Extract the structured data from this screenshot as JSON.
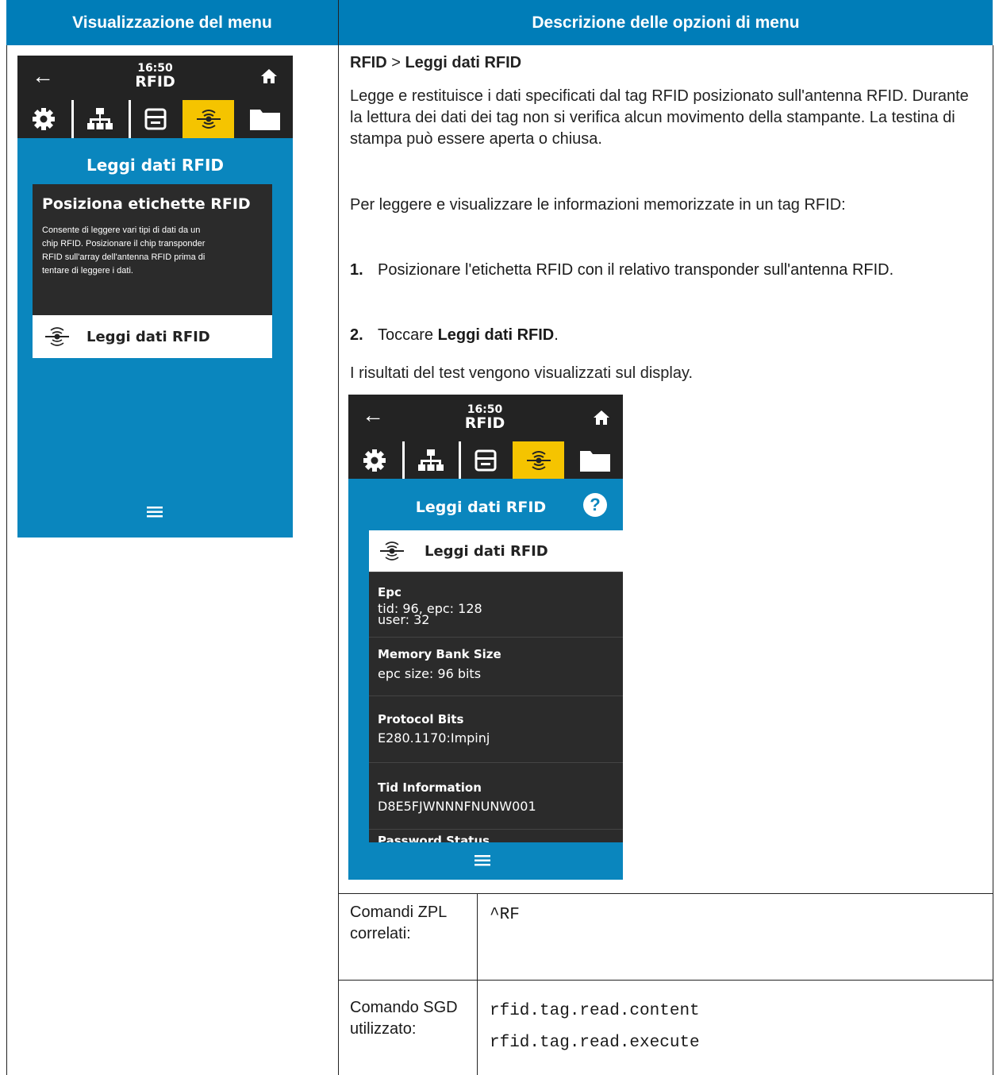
{
  "headers": {
    "left": "Visualizzazione del menu",
    "right": "Descrizione delle opzioni di menu"
  },
  "screen1": {
    "clock": "16:50",
    "section": "RFID",
    "title": "Leggi dati RFID",
    "card_title": "Posiziona etichette RFID",
    "card_lines": [
      "Consente di leggere vari tipi di dati da un",
      "chip RFID. Posizionare il chip transponder",
      "RFID sull'array dell'antenna RFID prima di",
      "tentare di leggere i dati."
    ],
    "button": "Leggi dati RFID",
    "active_tab_color": "#f5c400",
    "bg_color": "#0a86be"
  },
  "breadcrumb": {
    "part1": "RFID",
    "sep": " > ",
    "part2": "Leggi dati RFID"
  },
  "desc": {
    "p1": "Legge e restituisce i dati specificati dal tag RFID posizionato sull'antenna RFID. Durante la lettura dei dati dei tag non si verifica alcun movimento della stampante. La testina di stampa può essere aperta o chiusa.",
    "p2": "Per leggere e visualizzare le informazioni memorizzate in un tag RFID:",
    "step1_num": "1.",
    "step1": "Posizionare l'etichetta RFID con il relativo transponder sull'antenna RFID.",
    "step2_num": "2.",
    "step2_pre": "Toccare ",
    "step2_bold": "Leggi dati RFID",
    "step2_post": ".",
    "p3": "I risultati del test vengono visualizzati sul display."
  },
  "screen2": {
    "clock": "16:50",
    "section": "RFID",
    "title": "Leggi dati RFID",
    "help": "?",
    "button": "Leggi dati RFID",
    "rows": [
      {
        "key": "Epc",
        "val1": "tid: 96, epc: 128",
        "val2": "user: 32"
      },
      {
        "key": "Memory Bank Size",
        "val1": "epc size: 96 bits",
        "val2": ""
      },
      {
        "key": "Protocol Bits",
        "val1": "E280.1170:Impinj",
        "val2": ""
      },
      {
        "key": "Tid Information",
        "val1": "D8E5FJWNNNFNUNW001",
        "val2": ""
      },
      {
        "key": "Password Status",
        "val1": "",
        "val2": ""
      }
    ]
  },
  "commands": {
    "zpl_label": "Comandi ZPL correlati:",
    "zpl_value": "^RF",
    "sgd_label": "Comando SGD utilizzato:",
    "sgd_values": [
      "rfid.tag.read.content",
      "rfid.tag.read.execute"
    ]
  }
}
